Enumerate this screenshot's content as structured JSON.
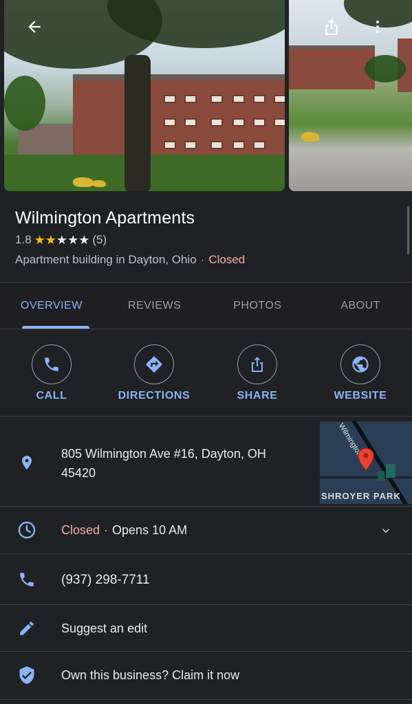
{
  "place": {
    "name": "Wilmington Apartments",
    "rating": "1.8",
    "rating_value": 1.8,
    "review_count": "(5)",
    "category": "Apartment building in Dayton, Ohio",
    "status": "Closed",
    "separator": "·"
  },
  "tabs": [
    {
      "label": "OVERVIEW",
      "active": true
    },
    {
      "label": "REVIEWS",
      "active": false
    },
    {
      "label": "PHOTOS",
      "active": false
    },
    {
      "label": "ABOUT",
      "active": false
    }
  ],
  "actions": [
    {
      "label": "CALL",
      "icon": "phone-icon"
    },
    {
      "label": "DIRECTIONS",
      "icon": "directions-icon"
    },
    {
      "label": "SHARE",
      "icon": "share-icon"
    },
    {
      "label": "WEBSITE",
      "icon": "globe-icon"
    }
  ],
  "address": {
    "line1": "805 Wilmington Ave #16, Dayton, OH",
    "line2": "45420"
  },
  "map": {
    "street": "Wilmington Ave",
    "area": "SHROYER PARK"
  },
  "hours": {
    "status": "Closed",
    "separator": "·",
    "opens": "Opens 10 AM"
  },
  "phone": "(937) 298-7711",
  "suggest_edit": "Suggest an edit",
  "claim": "Own this business? Claim it now",
  "colors": {
    "accent": "#8ab4f8",
    "closed": "#f6aea9",
    "star": "#fbbc04",
    "background": "#202124",
    "pin": "#ea4335"
  }
}
